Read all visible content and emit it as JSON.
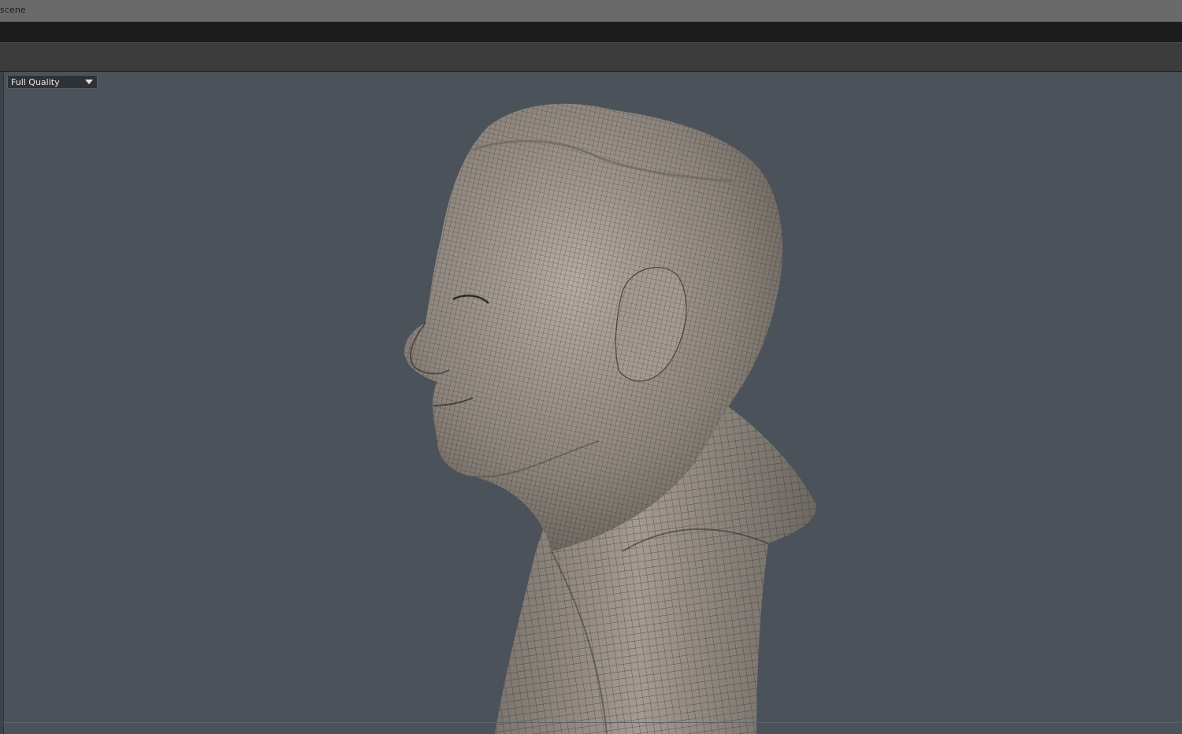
{
  "window": {
    "title": "scene"
  },
  "viewport": {
    "quality_dropdown": {
      "selected": "Full Quality"
    },
    "model": {
      "description_icon": "head-bust-wireframe-model"
    }
  },
  "colors": {
    "viewport_bg": "#4c525a",
    "titlebar_bg": "#6a6a6a",
    "menubar_bg": "#1c1c1c",
    "toolbar_bg": "#3c3c3c",
    "mesh_base": "#8f877f"
  }
}
